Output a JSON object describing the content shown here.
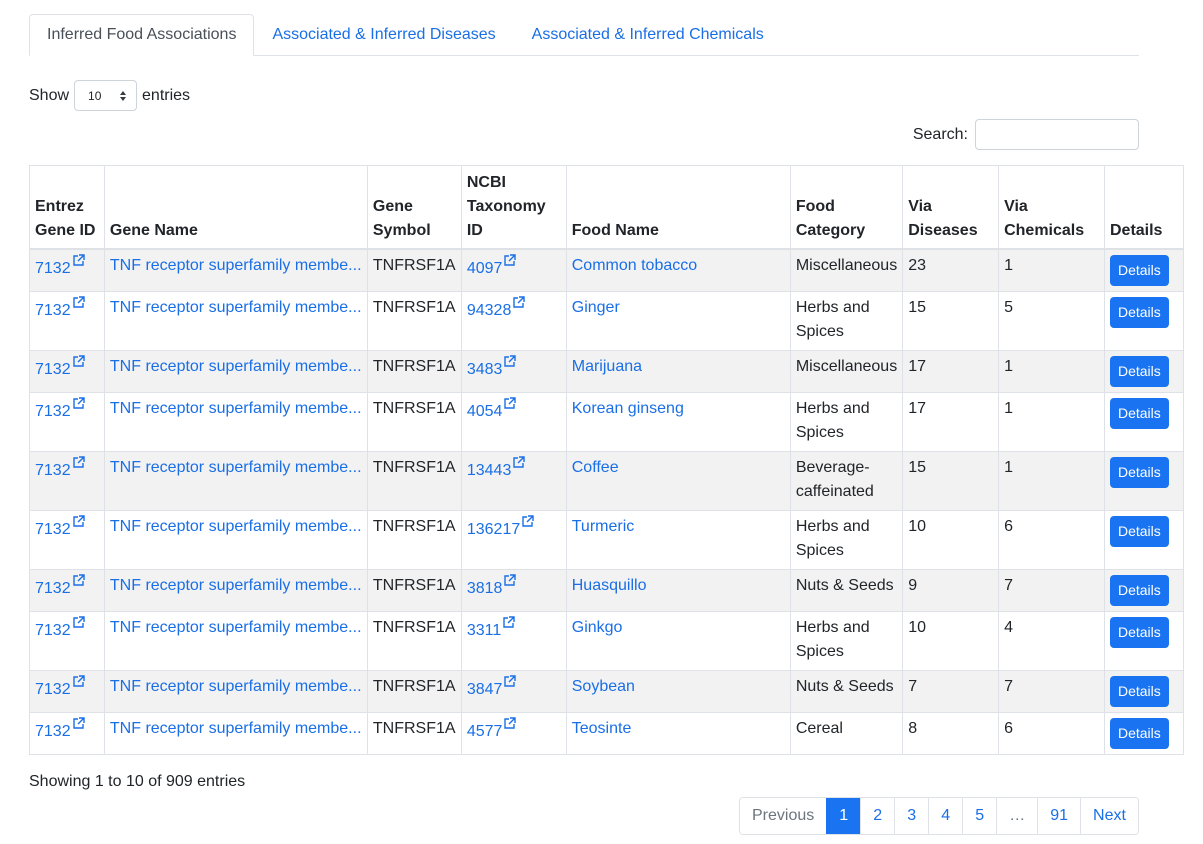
{
  "tabs": [
    {
      "label": "Inferred Food Associations",
      "active": true
    },
    {
      "label": "Associated & Inferred Diseases",
      "active": false
    },
    {
      "label": "Associated & Inferred Chemicals",
      "active": false
    }
  ],
  "length_control": {
    "show_label": "Show",
    "value": "10",
    "entries_label": "entries"
  },
  "search": {
    "label": "Search:",
    "value": ""
  },
  "table": {
    "headers": {
      "gene_id": "Entrez Gene ID",
      "gene_name": "Gene Name",
      "gene_symbol": "Gene Symbol",
      "taxonomy_id": "NCBI Taxonomy ID",
      "food_name": "Food Name",
      "food_category": "Food Category",
      "via_diseases": "Via Diseases",
      "via_chemicals": "Via Chemicals",
      "details": "Details"
    },
    "rows": [
      {
        "gene_id": "7132",
        "gene_name": "TNF receptor superfamily membe...",
        "gene_symbol": "TNFRSF1A",
        "taxonomy_id": "4097",
        "food_name": "Common tobacco",
        "food_category": "Miscellaneous",
        "via_diseases": "23",
        "via_chemicals": "1",
        "details": "Details"
      },
      {
        "gene_id": "7132",
        "gene_name": "TNF receptor superfamily membe...",
        "gene_symbol": "TNFRSF1A",
        "taxonomy_id": "94328",
        "food_name": "Ginger",
        "food_category": "Herbs and Spices",
        "via_diseases": "15",
        "via_chemicals": "5",
        "details": "Details"
      },
      {
        "gene_id": "7132",
        "gene_name": "TNF receptor superfamily membe...",
        "gene_symbol": "TNFRSF1A",
        "taxonomy_id": "3483",
        "food_name": "Marijuana",
        "food_category": "Miscellaneous",
        "via_diseases": "17",
        "via_chemicals": "1",
        "details": "Details"
      },
      {
        "gene_id": "7132",
        "gene_name": "TNF receptor superfamily membe...",
        "gene_symbol": "TNFRSF1A",
        "taxonomy_id": "4054",
        "food_name": "Korean ginseng",
        "food_category": "Herbs and Spices",
        "via_diseases": "17",
        "via_chemicals": "1",
        "details": "Details"
      },
      {
        "gene_id": "7132",
        "gene_name": "TNF receptor superfamily membe...",
        "gene_symbol": "TNFRSF1A",
        "taxonomy_id": "13443",
        "food_name": "Coffee",
        "food_category": "Beverage-caffeinated",
        "via_diseases": "15",
        "via_chemicals": "1",
        "details": "Details"
      },
      {
        "gene_id": "7132",
        "gene_name": "TNF receptor superfamily membe...",
        "gene_symbol": "TNFRSF1A",
        "taxonomy_id": "136217",
        "food_name": "Turmeric",
        "food_category": "Herbs and Spices",
        "via_diseases": "10",
        "via_chemicals": "6",
        "details": "Details"
      },
      {
        "gene_id": "7132",
        "gene_name": "TNF receptor superfamily membe...",
        "gene_symbol": "TNFRSF1A",
        "taxonomy_id": "3818",
        "food_name": "Huasquillo",
        "food_category": "Nuts & Seeds",
        "via_diseases": "9",
        "via_chemicals": "7",
        "details": "Details"
      },
      {
        "gene_id": "7132",
        "gene_name": "TNF receptor superfamily membe...",
        "gene_symbol": "TNFRSF1A",
        "taxonomy_id": "3311",
        "food_name": "Ginkgo",
        "food_category": "Herbs and Spices",
        "via_diseases": "10",
        "via_chemicals": "4",
        "details": "Details"
      },
      {
        "gene_id": "7132",
        "gene_name": "TNF receptor superfamily membe...",
        "gene_symbol": "TNFRSF1A",
        "taxonomy_id": "3847",
        "food_name": "Soybean",
        "food_category": "Nuts & Seeds",
        "via_diseases": "7",
        "via_chemicals": "7",
        "details": "Details"
      },
      {
        "gene_id": "7132",
        "gene_name": "TNF receptor superfamily membe...",
        "gene_symbol": "TNFRSF1A",
        "taxonomy_id": "4577",
        "food_name": "Teosinte",
        "food_category": "Cereal",
        "via_diseases": "8",
        "via_chemicals": "6",
        "details": "Details"
      }
    ]
  },
  "info": "Showing 1 to 10 of 909 entries",
  "pagination": {
    "previous": "Previous",
    "pages": [
      "1",
      "2",
      "3",
      "4",
      "5",
      "…",
      "91"
    ],
    "current": "1",
    "next": "Next"
  },
  "colors": {
    "link": "#1a6fe6",
    "button": "#1a74f2",
    "stripe": "#f2f2f2",
    "border": "#dee2e6"
  }
}
